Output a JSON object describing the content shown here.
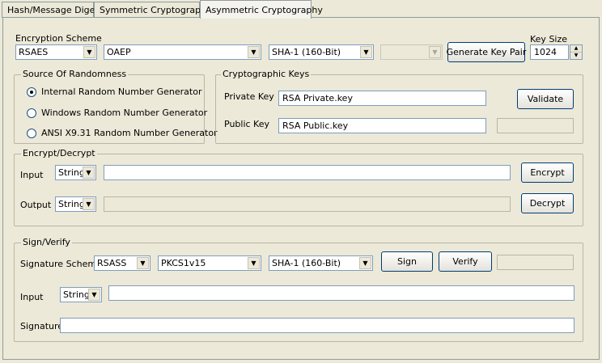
{
  "tabs": [
    {
      "label": "Hash/Message Digest"
    },
    {
      "label": "Symmetric Cryptography"
    },
    {
      "label": "Asymmetric Cryptography"
    }
  ],
  "top": {
    "scheme_label": "Encryption Scheme",
    "scheme": "RSAES",
    "padding": "OAEP",
    "hash": "SHA-1 (160-Bit)",
    "extra": "",
    "generate_label": "Generate Key Pair",
    "keysize_label": "Key Size",
    "keysize": "1024"
  },
  "randomness": {
    "legend": "Source Of Randomness",
    "options": [
      {
        "label": "Internal Random Number Generator"
      },
      {
        "label": "Windows Random Number Generator"
      },
      {
        "label": "ANSI X9.31 Random Number Generator"
      }
    ]
  },
  "keys": {
    "legend": "Cryptographic Keys",
    "private_label": "Private Key",
    "private_value": "RSA Private.key",
    "public_label": "Public Key",
    "public_value": "RSA Public.key",
    "validate_label": "Validate",
    "status": ""
  },
  "encdec": {
    "legend": "Encrypt/Decrypt",
    "input_label": "Input",
    "input_format": "String",
    "input_value": "",
    "output_label": "Output",
    "output_format": "String",
    "output_value": "",
    "encrypt_label": "Encrypt",
    "decrypt_label": "Decrypt"
  },
  "sign": {
    "legend": "Sign/Verify",
    "scheme_label": "Signature Scheme",
    "scheme": "RSASS",
    "padding": "PKCS1v15",
    "hash": "SHA-1 (160-Bit)",
    "sign_label": "Sign",
    "verify_label": "Verify",
    "status": "",
    "input_label": "Input",
    "input_format": "String",
    "input_value": "",
    "signature_label": "Signature",
    "signature_value": ""
  }
}
